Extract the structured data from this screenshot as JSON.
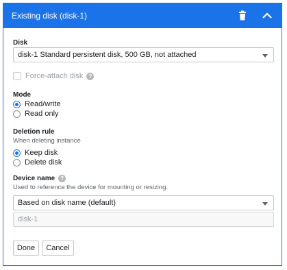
{
  "header": {
    "title": "Existing disk (disk-1)",
    "delete_icon": "trash-icon",
    "collapse_icon": "chevron-up-icon"
  },
  "disk": {
    "label": "Disk",
    "selected": "disk-1 Standard persistent disk, 500 GB, not attached"
  },
  "force_attach": {
    "label": "Force-attach disk",
    "checked": false,
    "disabled": true,
    "help_icon": "help-icon"
  },
  "mode": {
    "label": "Mode",
    "options": [
      {
        "label": "Read/write",
        "checked": true
      },
      {
        "label": "Read only",
        "checked": false
      }
    ]
  },
  "deletion_rule": {
    "label": "Deletion rule",
    "hint": "When deleting instance",
    "options": [
      {
        "label": "Keep disk",
        "checked": true
      },
      {
        "label": "Delete disk",
        "checked": false
      }
    ]
  },
  "device_name": {
    "label": "Device name",
    "hint": "Used to reference the device for mounting or resizing.",
    "help_icon": "help-icon",
    "selected": "Based on disk name (default)",
    "value": "disk-1"
  },
  "actions": {
    "done_label": "Done",
    "cancel_label": "Cancel"
  },
  "colors": {
    "accent": "#1a73e8",
    "header_text": "#ffffff"
  }
}
